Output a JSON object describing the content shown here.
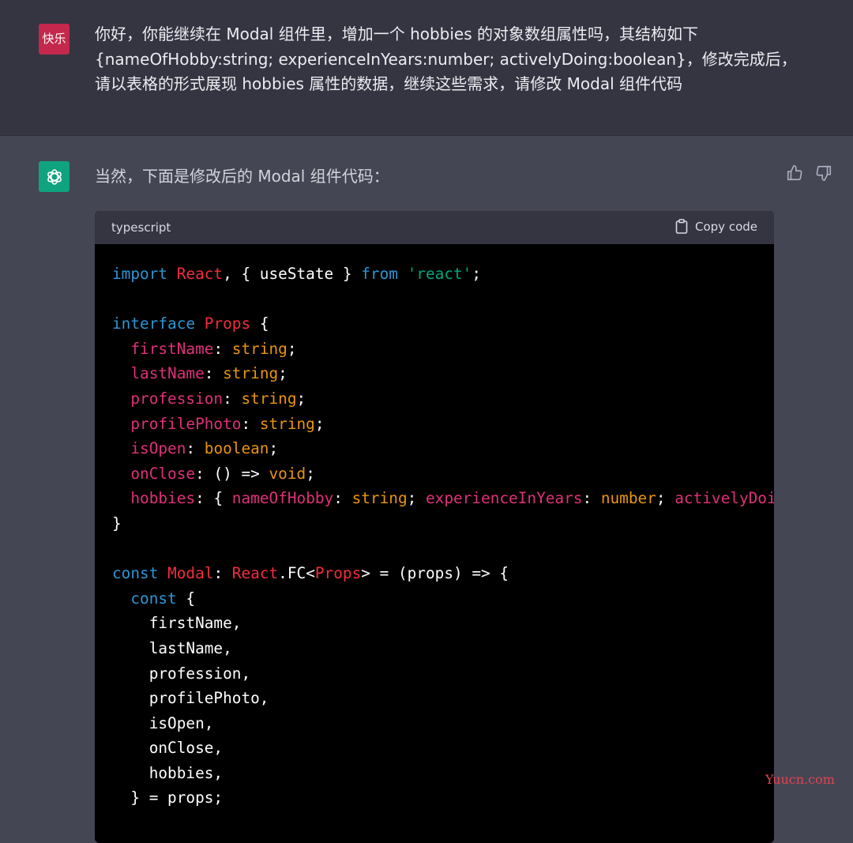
{
  "user": {
    "avatar_text": "快乐",
    "message_lines": [
      "你好，你能继续在 Modal 组件里，增加一个 hobbies 的对象数组属性吗，其结构如下",
      "{nameOfHobby:string; experienceInYears:number; activelyDoing:boolean}，修改完成后，",
      "请以表格的形式展现 hobbies 属性的数据，继续这些需求，请修改 Modal 组件代码"
    ]
  },
  "assistant": {
    "intro": "当然，下面是修改后的 Modal 组件代码：",
    "avatar_icon": "openai-logo-icon",
    "feedback": {
      "up_icon": "thumbs-up-icon",
      "down_icon": "thumbs-down-icon"
    }
  },
  "code_block": {
    "language": "typescript",
    "copy_label": "Copy code",
    "copy_icon": "clipboard-icon",
    "lines": [
      [
        {
          "t": "import",
          "c": "kw"
        },
        {
          "t": " ",
          "c": "pl"
        },
        {
          "t": "React",
          "c": "ne"
        },
        {
          "t": ", { useState } ",
          "c": "pl"
        },
        {
          "t": "from",
          "c": "kw"
        },
        {
          "t": " ",
          "c": "pl"
        },
        {
          "t": "'react'",
          "c": "str"
        },
        {
          "t": ";",
          "c": "pl"
        }
      ],
      [],
      [
        {
          "t": "interface",
          "c": "kw"
        },
        {
          "t": " ",
          "c": "pl"
        },
        {
          "t": "Props",
          "c": "ne"
        },
        {
          "t": " {",
          "c": "pl"
        }
      ],
      [
        {
          "t": "  ",
          "c": "pl"
        },
        {
          "t": "firstName",
          "c": "pr"
        },
        {
          "t": ": ",
          "c": "pl"
        },
        {
          "t": "string",
          "c": "tp"
        },
        {
          "t": ";",
          "c": "pl"
        }
      ],
      [
        {
          "t": "  ",
          "c": "pl"
        },
        {
          "t": "lastName",
          "c": "pr"
        },
        {
          "t": ": ",
          "c": "pl"
        },
        {
          "t": "string",
          "c": "tp"
        },
        {
          "t": ";",
          "c": "pl"
        }
      ],
      [
        {
          "t": "  ",
          "c": "pl"
        },
        {
          "t": "profession",
          "c": "pr"
        },
        {
          "t": ": ",
          "c": "pl"
        },
        {
          "t": "string",
          "c": "tp"
        },
        {
          "t": ";",
          "c": "pl"
        }
      ],
      [
        {
          "t": "  ",
          "c": "pl"
        },
        {
          "t": "profilePhoto",
          "c": "pr"
        },
        {
          "t": ": ",
          "c": "pl"
        },
        {
          "t": "string",
          "c": "tp"
        },
        {
          "t": ";",
          "c": "pl"
        }
      ],
      [
        {
          "t": "  ",
          "c": "pl"
        },
        {
          "t": "isOpen",
          "c": "pr"
        },
        {
          "t": ": ",
          "c": "pl"
        },
        {
          "t": "boolean",
          "c": "tp"
        },
        {
          "t": ";",
          "c": "pl"
        }
      ],
      [
        {
          "t": "  ",
          "c": "pl"
        },
        {
          "t": "onClose",
          "c": "pr"
        },
        {
          "t": ": () => ",
          "c": "pl"
        },
        {
          "t": "void",
          "c": "tp"
        },
        {
          "t": ";",
          "c": "pl"
        }
      ],
      [
        {
          "t": "  ",
          "c": "pl"
        },
        {
          "t": "hobbies",
          "c": "pr"
        },
        {
          "t": ": { ",
          "c": "pl"
        },
        {
          "t": "nameOfHobby",
          "c": "pr"
        },
        {
          "t": ": ",
          "c": "pl"
        },
        {
          "t": "string",
          "c": "tp"
        },
        {
          "t": "; ",
          "c": "pl"
        },
        {
          "t": "experienceInYears",
          "c": "pr"
        },
        {
          "t": ": ",
          "c": "pl"
        },
        {
          "t": "number",
          "c": "tp"
        },
        {
          "t": "; ",
          "c": "pl"
        },
        {
          "t": "activelyDoing",
          "c": "pr"
        },
        {
          "t": ":",
          "c": "pl"
        }
      ],
      [
        {
          "t": "}",
          "c": "pl"
        }
      ],
      [],
      [
        {
          "t": "const",
          "c": "kw"
        },
        {
          "t": " ",
          "c": "pl"
        },
        {
          "t": "Modal",
          "c": "ne"
        },
        {
          "t": ": ",
          "c": "pl"
        },
        {
          "t": "React",
          "c": "ne"
        },
        {
          "t": ".FC<",
          "c": "pl"
        },
        {
          "t": "Props",
          "c": "ne"
        },
        {
          "t": "> = (props) => {",
          "c": "pl"
        }
      ],
      [
        {
          "t": "  ",
          "c": "pl"
        },
        {
          "t": "const",
          "c": "kw"
        },
        {
          "t": " {",
          "c": "pl"
        }
      ],
      [
        {
          "t": "    firstName,",
          "c": "pl"
        }
      ],
      [
        {
          "t": "    lastName,",
          "c": "pl"
        }
      ],
      [
        {
          "t": "    profession,",
          "c": "pl"
        }
      ],
      [
        {
          "t": "    profilePhoto,",
          "c": "pl"
        }
      ],
      [
        {
          "t": "    isOpen,",
          "c": "pl"
        }
      ],
      [
        {
          "t": "    onClose,",
          "c": "pl"
        }
      ],
      [
        {
          "t": "    hobbies,",
          "c": "pl"
        }
      ],
      [
        {
          "t": "  } = props;",
          "c": "pl"
        }
      ]
    ]
  },
  "watermark": "Yuucn.com",
  "colors": {
    "user_bg": "#343541",
    "assistant_bg": "#444654",
    "user_avatar": "#c4284c",
    "gpt_avatar": "#10a37f",
    "code_bg": "#000000",
    "keyword": "#2e95d3",
    "property": "#df3079",
    "type": "#e9950c",
    "string": "#00a67d",
    "name": "#f22c3d"
  }
}
